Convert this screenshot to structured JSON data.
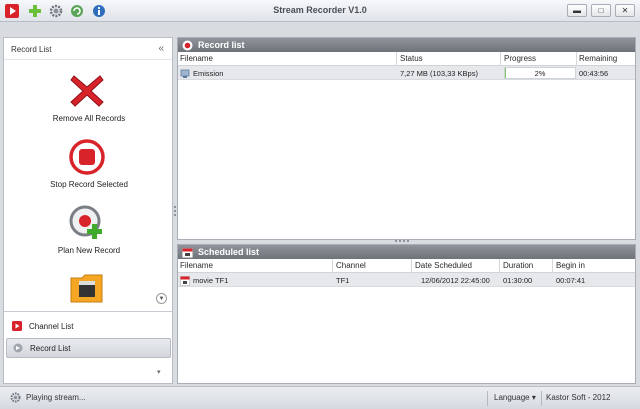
{
  "window": {
    "title": "Stream Recorder V1.0"
  },
  "quick_toolbar": [
    "record-icon",
    "add-icon",
    "gear-icon",
    "refresh-icon",
    "info-icon"
  ],
  "window_buttons": {
    "minimize": "▬",
    "maximize": "□",
    "close": "✕"
  },
  "sidebar": {
    "title": "Record List",
    "collapse_glyph": "«",
    "actions": [
      {
        "label": "Remove All Records",
        "icon": "remove-all-icon"
      },
      {
        "label": "Stop Record Selected",
        "icon": "stop-record-icon"
      },
      {
        "label": "Plan New Record",
        "icon": "plan-record-icon"
      },
      {
        "label": "",
        "icon": "media-folder-icon"
      }
    ],
    "nav": [
      {
        "label": "Channel List",
        "icon": "channel-list-icon",
        "selected": false
      },
      {
        "label": "Record List",
        "icon": "record-list-icon",
        "selected": true
      }
    ]
  },
  "record_list": {
    "title": "Record list",
    "columns": [
      "Filename",
      "Status",
      "Progress",
      "Remaining"
    ],
    "rows": [
      {
        "filename": "Emission",
        "status": "7,27 MB (103,33 KBps)",
        "progress": 0.02,
        "progress_text": "2%",
        "remaining": "00:43:56"
      }
    ]
  },
  "scheduled_list": {
    "title": "Scheduled list",
    "columns": [
      "Filename",
      "Channel",
      "Date Scheduled",
      "Duration",
      "Begin in"
    ],
    "rows": [
      {
        "filename": "movie TF1",
        "channel": "TF1",
        "date": "12/06/2012 22:45:00",
        "duration": "01:30:00",
        "begin_in": "00:07:41"
      }
    ]
  },
  "status_bar": {
    "text": "Playing stream...",
    "language": "Language ▾",
    "credit": "Kastor Soft - 2012"
  },
  "colors": {
    "accent_red": "#d8232a",
    "progress_green": "#7ec86b",
    "header_gray": "#7a7f86"
  }
}
